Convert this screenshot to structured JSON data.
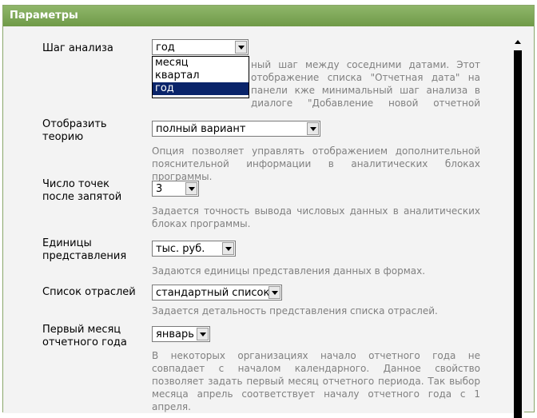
{
  "panel": {
    "title": "Параметры"
  },
  "settings": {
    "step": {
      "label": "Шаг анализа",
      "value": "год",
      "options": [
        "месяц",
        "квартал",
        "год"
      ],
      "description_visible": "ный шаг между соседними датами. Этот отображение списка \"Отчетная дата\" на панели кже минимальный шаг анализа в диалоге \"Добавление новой отчетной даты\"."
    },
    "theory": {
      "label": "Отобразить теорию",
      "value": "полный вариант",
      "description": "Опция позволяет управлять отображением дополнительной пояснительной информации в аналитических блоках программы."
    },
    "decimals": {
      "label": "Число точек после запятой",
      "value": "3",
      "description": "Задается точность вывода числовых данных в аналитических блоках программы."
    },
    "units": {
      "label": "Единицы представления",
      "value": "тыс. руб.",
      "description": "Задаются единицы представления данных в формах."
    },
    "industries": {
      "label": "Список отраслей",
      "value": "стандартный список",
      "description": "Задается детальность представления списка отраслей."
    },
    "first_month": {
      "label": "Первый месяц отчетного года",
      "value": "январь",
      "description": "В некоторых организациях начало отчетного года не совпадает с началом календарного. Данное свойство позволяет задать первый месяц отчетного периода. Так выбор месяца апрель соответствует началу отчетного года с 1 апреля."
    }
  }
}
